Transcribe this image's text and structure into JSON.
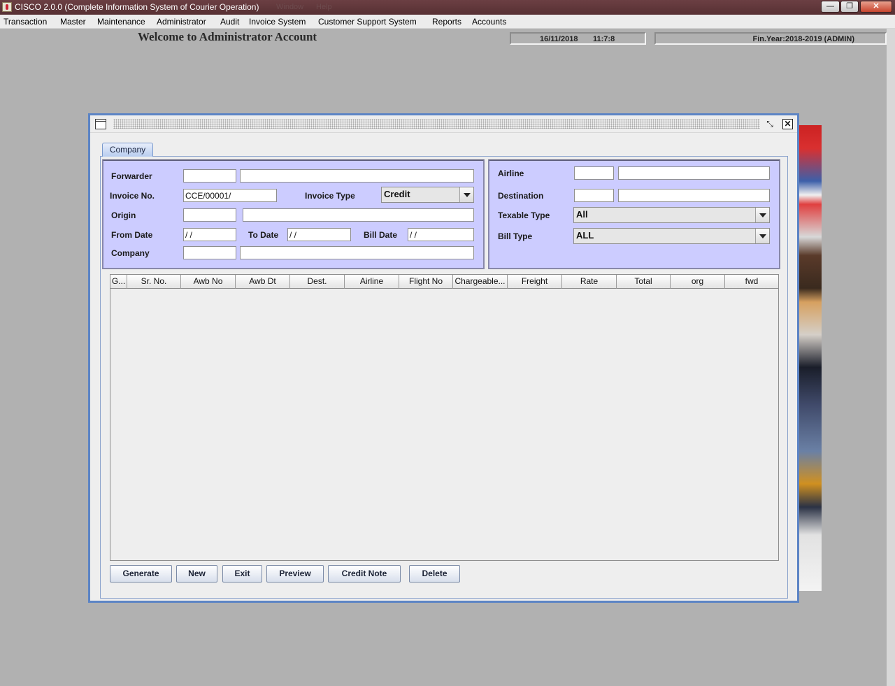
{
  "window": {
    "title": "CISCO 2.0.0 (Complete Information System of Courier Operation)",
    "faint_menu": [
      "Window",
      "Help"
    ]
  },
  "menu": [
    "Transaction",
    "Master",
    "Maintenance",
    "Administrator",
    "Audit",
    "Invoice System",
    "Customer Support System",
    "Reports",
    "Accounts"
  ],
  "status": {
    "welcome": "Welcome to Administrator Account",
    "date": "16/11/2018",
    "time": "11:7:8",
    "fin_year": "Fin.Year:2018-2019  (ADMIN)"
  },
  "tab": {
    "label": "Company"
  },
  "form": {
    "labels": {
      "forwarder": "Forwarder",
      "invoice_no": "Invoice No.",
      "invoice_type": "Invoice Type",
      "origin": "Origin",
      "from_date": "From Date",
      "to_date": "To Date",
      "bill_date": "Bill Date",
      "company": "Company",
      "airline": "Airline",
      "destination": "Destination",
      "texable_type": "Texable Type",
      "bill_type": "Bill Type"
    },
    "values": {
      "invoice_no": "CCE/00001/",
      "invoice_type": "Credit",
      "from_date": " / /",
      "to_date": " / /",
      "bill_date": " / /",
      "texable_type": "All",
      "bill_type": "ALL"
    }
  },
  "table": {
    "columns": [
      "G...",
      "Sr. No.",
      "Awb No",
      "Awb Dt",
      "Dest.",
      "Airline",
      "Flight No",
      "Chargeable...",
      "Freight",
      "Rate",
      "Total",
      "org",
      "fwd"
    ]
  },
  "buttons": {
    "generate": "Generate",
    "new": "New",
    "exit": "Exit",
    "preview": "Preview",
    "credit_note": "Credit Note",
    "delete": "Delete"
  },
  "window_controls": {
    "minimize": "—",
    "maximize": "❐",
    "close": "✕"
  },
  "frame_controls": {
    "restore": "⤡",
    "close": "✕"
  }
}
